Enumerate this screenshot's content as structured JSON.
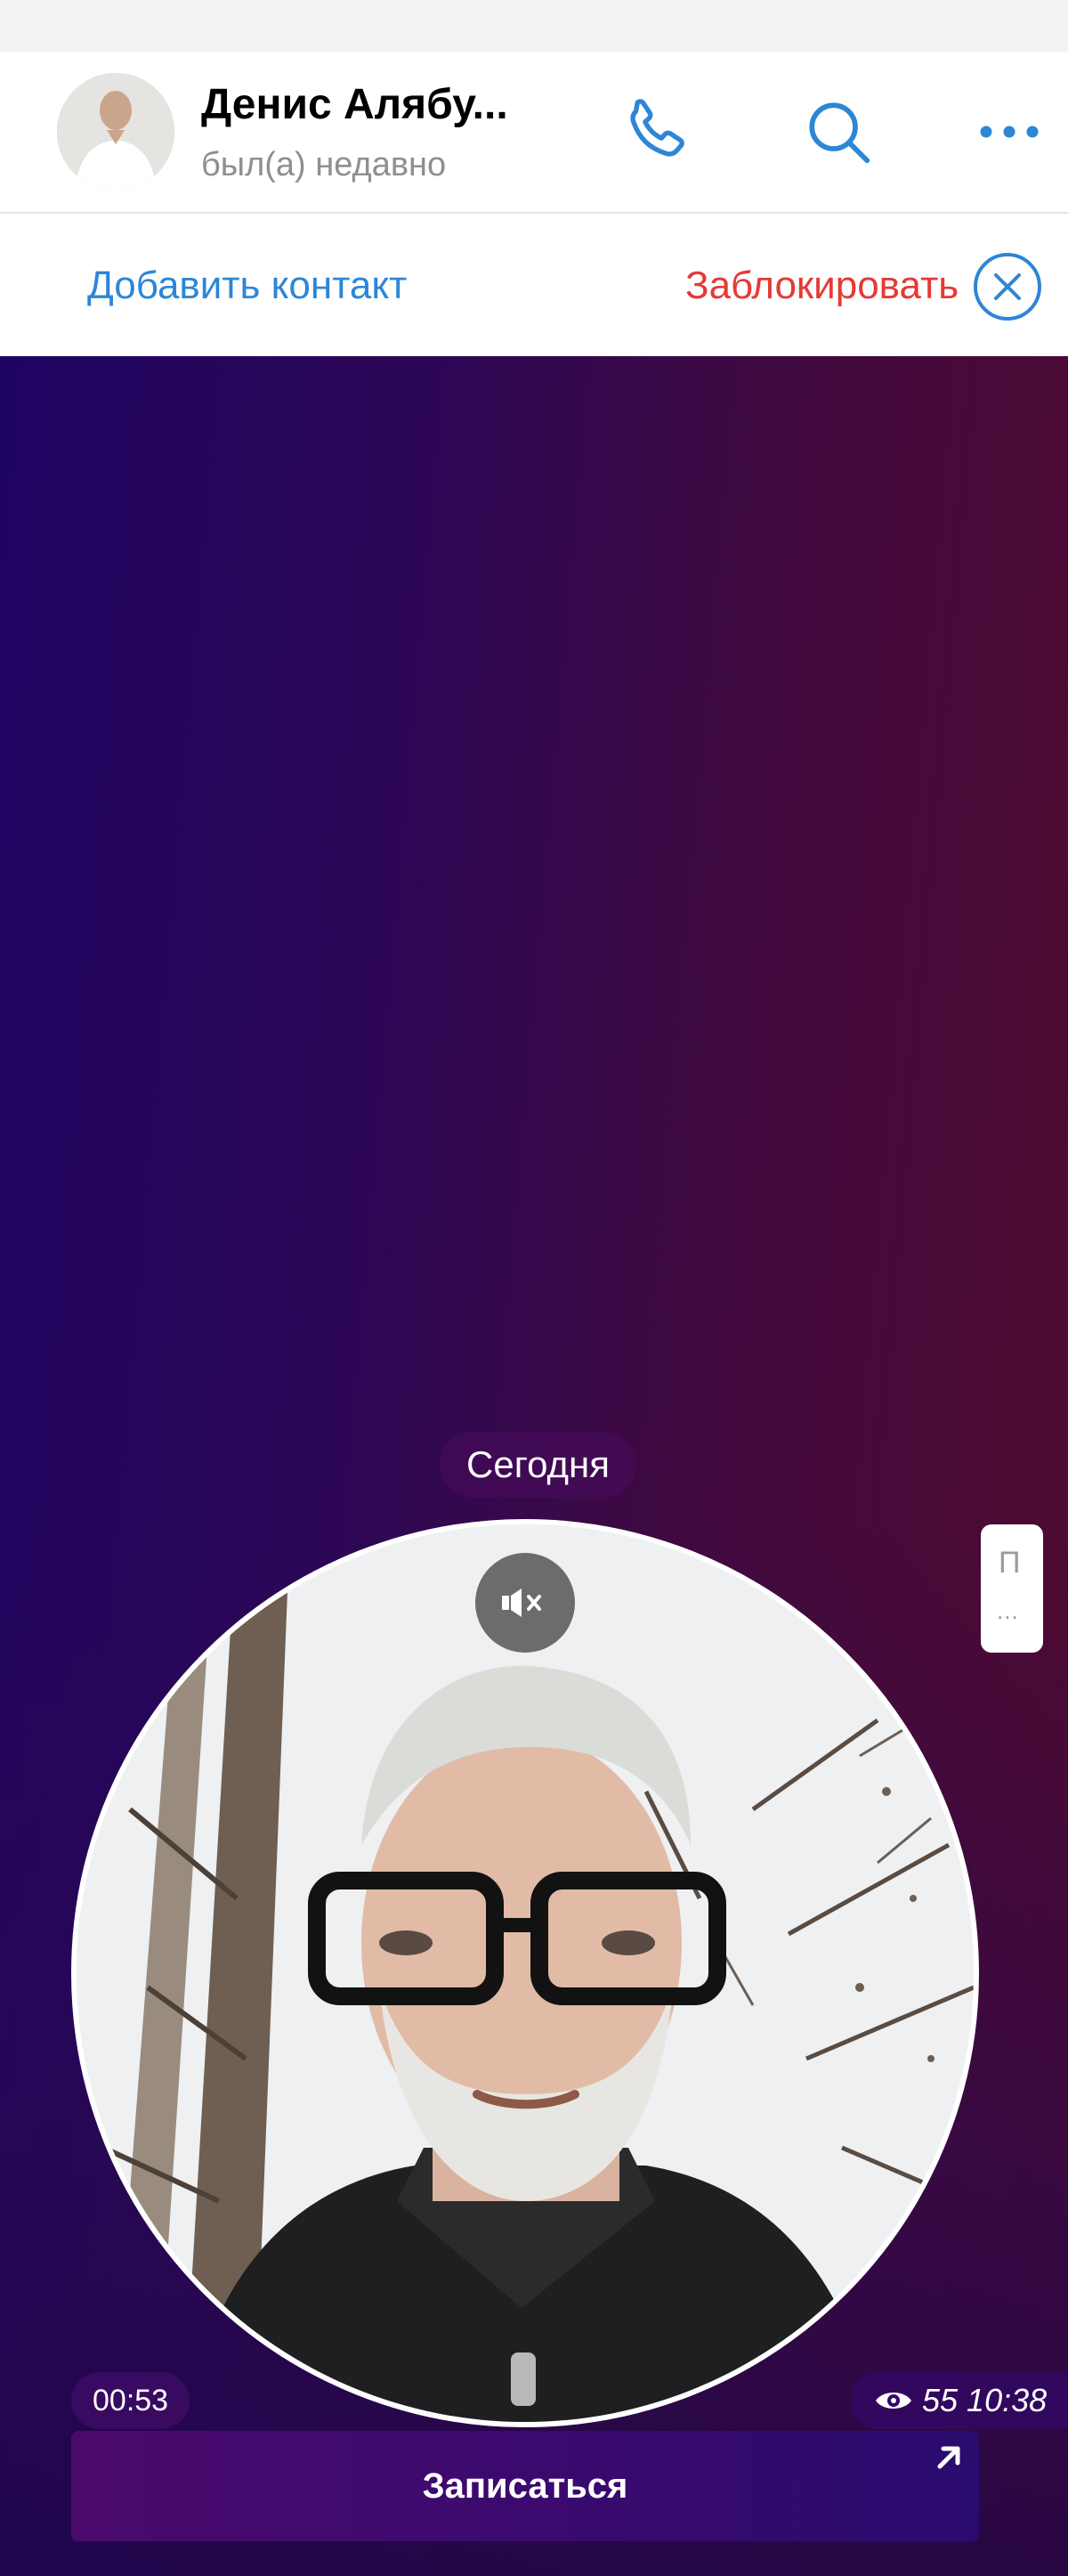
{
  "header": {
    "peer_name": "Денис Алябу...",
    "peer_status": "был(а) недавно",
    "icons": [
      "phone-icon",
      "search-icon",
      "more-icon"
    ]
  },
  "action_bar": {
    "add_contact_label": "Добавить контакт",
    "block_label": "Заблокировать",
    "close_icon": "close-circle-icon"
  },
  "chat": {
    "date_separator": "Сегодня",
    "video_message": {
      "duration": "00:53",
      "views": "55",
      "time": "10:38",
      "muted": true
    },
    "side_card": {
      "letter": "П",
      "ellipsis": "..."
    },
    "cta_button_label": "Записаться"
  },
  "colors": {
    "accent": "#2d86d6",
    "danger": "#e53935",
    "background_gradient": [
      "#1e0462",
      "#510a2e"
    ]
  }
}
